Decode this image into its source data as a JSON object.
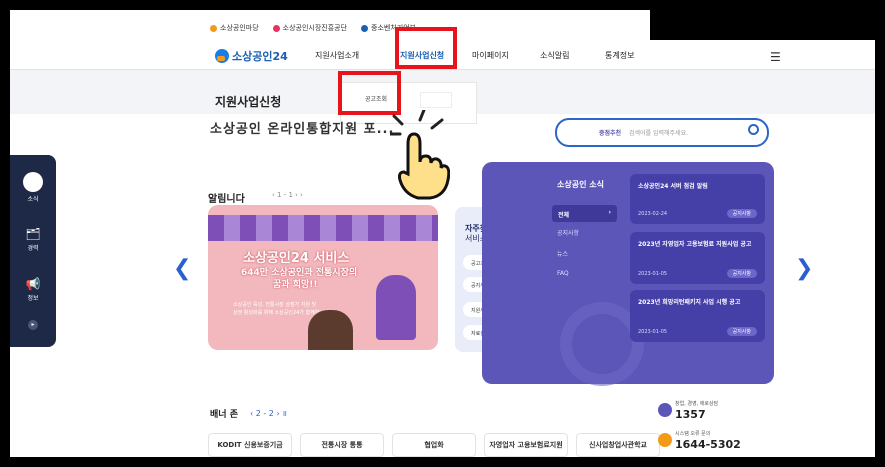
{
  "topbar": {
    "links": [
      "소상공인마당",
      "소상공인시장진흥공단",
      "중소벤처기업부"
    ]
  },
  "logo": {
    "text": "소상공인24"
  },
  "nav": {
    "items": [
      "지원사업소개",
      "지원사업신청",
      "마이페이지",
      "소식알림",
      "통계정보"
    ]
  },
  "subheader": {
    "title": "지원사업신청",
    "dropdown_item": "공고조회"
  },
  "hero": {
    "partial_text": "소상공인 온라인통합지원 포...",
    "search_tag": "중점추천",
    "search_placeholder": "검색어를 입력해주세요."
  },
  "leftnav": {
    "items": [
      "소식",
      "경력",
      "정보"
    ]
  },
  "notice": {
    "title": "알림니다",
    "pager": "‹ 1 - 1 › ›"
  },
  "promo": {
    "line1": "소상공인24 서비스",
    "line2": "644만 소상공인과 전통시장의",
    "line3": "꿈과 희망!!",
    "desc1": "소상공인 육성, 전통시장 상점가 지원 및",
    "desc2": "상권 활성화를 위해 소상공인24가 함께합니다."
  },
  "faq": {
    "title1": "자주찾는",
    "title2": "서비스",
    "items": [
      "공고조회",
      "공지사항",
      "지원사업상담",
      "자료실"
    ]
  },
  "news": {
    "title": "소상공인 소식",
    "categories": [
      "전체",
      "공지사항",
      "뉴스",
      "FAQ"
    ],
    "cards": [
      {
        "title": "소상공인24 서버 점검 알림",
        "date": "2023-02-24",
        "badge": "공지사항"
      },
      {
        "title": "2023년 자영업자 고용보험료 지원사업 공고",
        "date": "2023-01-05",
        "badge": "공지사항"
      },
      {
        "title": "2023년 희망리턴패키지 사업 시행 공고",
        "date": "2023-01-05",
        "badge": "공지사항"
      }
    ]
  },
  "banner_zone": {
    "title": "배너 존",
    "pager": "‹ 2 - 2 › ॥",
    "logos": [
      "KODIT 신용보증기금",
      "전통시장 통통",
      "협업화",
      "자영업자 고용보험료지원",
      "신사업창업사관학교"
    ]
  },
  "contact": [
    {
      "label": "창업, 경영, 애로상담",
      "number": "1357"
    },
    {
      "label": "시스템 오류 문의",
      "number": "1644-5302"
    }
  ],
  "colors": {
    "brand": "#1a7ce6",
    "highlight": "#e8141c",
    "news_bg": "#5b56b8",
    "nav_dark": "#1e2847"
  }
}
